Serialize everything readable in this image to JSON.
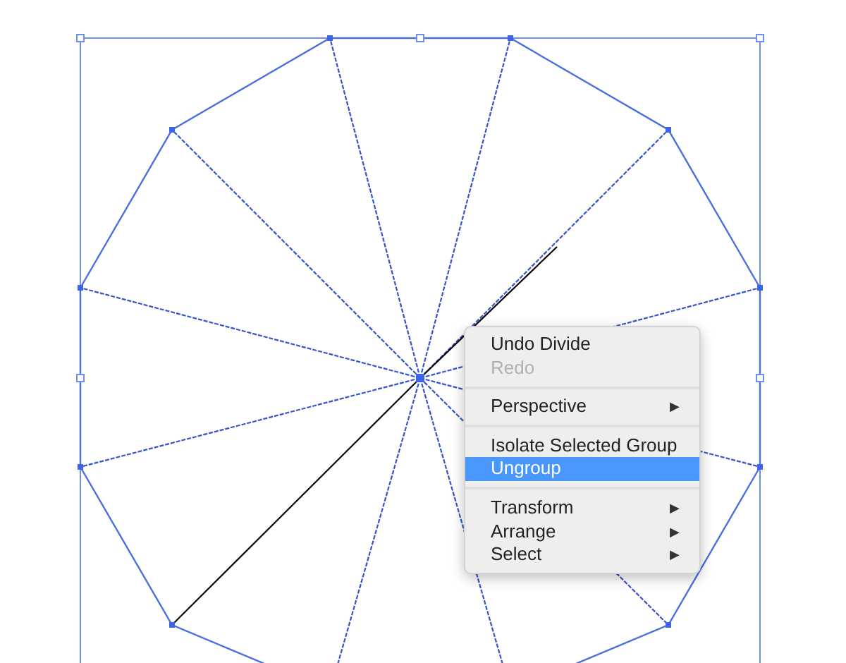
{
  "context_menu": {
    "items": [
      {
        "kind": "item",
        "label": "Undo Divide",
        "disabled": false,
        "selected": false
      },
      {
        "kind": "item",
        "label": "Redo",
        "disabled": true,
        "selected": false
      },
      {
        "kind": "separator"
      },
      {
        "kind": "item",
        "label": "Perspective",
        "disabled": false,
        "selected": false,
        "arrow": "▶"
      },
      {
        "kind": "separator"
      },
      {
        "kind": "item",
        "label": "Isolate Selected Group",
        "disabled": false,
        "selected": false
      },
      {
        "kind": "item",
        "label": "Ungroup",
        "disabled": false,
        "selected": true
      },
      {
        "kind": "separator"
      },
      {
        "kind": "item",
        "label": "Transform",
        "disabled": false,
        "selected": false,
        "arrow": "▶"
      },
      {
        "kind": "item",
        "label": "Arrange",
        "disabled": false,
        "selected": false,
        "arrow": "▶"
      },
      {
        "kind": "item",
        "label": "Select",
        "disabled": false,
        "selected": false,
        "arrow": "▶"
      }
    ]
  }
}
